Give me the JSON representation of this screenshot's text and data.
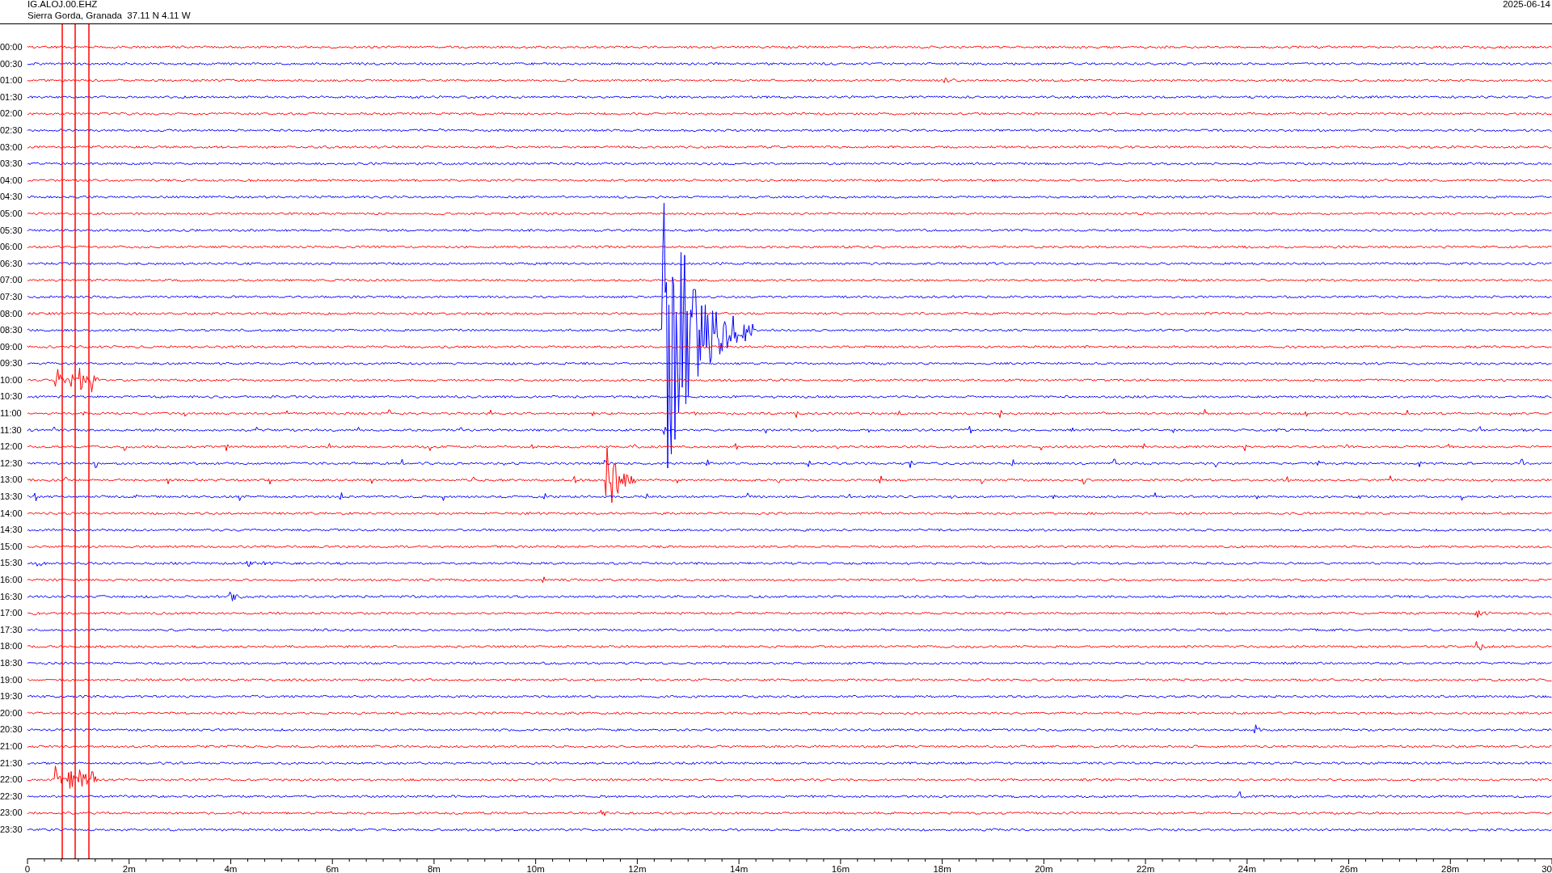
{
  "header": {
    "station": "IG.ALOJ.00.EHZ",
    "location": "Sierra Gorda, Granada  37.11 N 4.11 W",
    "date": "2025-06-14"
  },
  "rows": [
    {
      "label": "00:00",
      "color": "#ff0000"
    },
    {
      "label": "00:30",
      "color": "#0000ff"
    },
    {
      "label": "01:00",
      "color": "#ff0000"
    },
    {
      "label": "01:30",
      "color": "#0000ff"
    },
    {
      "label": "02:00",
      "color": "#ff0000"
    },
    {
      "label": "02:30",
      "color": "#0000ff"
    },
    {
      "label": "03:00",
      "color": "#ff0000"
    },
    {
      "label": "03:30",
      "color": "#0000ff"
    },
    {
      "label": "04:00",
      "color": "#ff0000"
    },
    {
      "label": "04:30",
      "color": "#0000ff"
    },
    {
      "label": "05:00",
      "color": "#ff0000"
    },
    {
      "label": "05:30",
      "color": "#0000ff"
    },
    {
      "label": "06:00",
      "color": "#ff0000"
    },
    {
      "label": "06:30",
      "color": "#0000ff"
    },
    {
      "label": "07:00",
      "color": "#ff0000"
    },
    {
      "label": "07:30",
      "color": "#0000ff"
    },
    {
      "label": "08:00",
      "color": "#ff0000"
    },
    {
      "label": "08:30",
      "color": "#0000ff"
    },
    {
      "label": "09:00",
      "color": "#ff0000"
    },
    {
      "label": "09:30",
      "color": "#0000ff"
    },
    {
      "label": "10:00",
      "color": "#ff0000"
    },
    {
      "label": "10:30",
      "color": "#0000ff"
    },
    {
      "label": "11:00",
      "color": "#ff0000"
    },
    {
      "label": "11:30",
      "color": "#0000ff"
    },
    {
      "label": "12:00",
      "color": "#ff0000"
    },
    {
      "label": "12:30",
      "color": "#0000ff"
    },
    {
      "label": "13:00",
      "color": "#ff0000"
    },
    {
      "label": "13:30",
      "color": "#0000ff"
    },
    {
      "label": "14:00",
      "color": "#ff0000"
    },
    {
      "label": "14:30",
      "color": "#0000ff"
    },
    {
      "label": "15:00",
      "color": "#ff0000"
    },
    {
      "label": "15:30",
      "color": "#0000ff"
    },
    {
      "label": "16:00",
      "color": "#ff0000"
    },
    {
      "label": "16:30",
      "color": "#0000ff"
    },
    {
      "label": "17:00",
      "color": "#ff0000"
    },
    {
      "label": "17:30",
      "color": "#0000ff"
    },
    {
      "label": "18:00",
      "color": "#ff0000"
    },
    {
      "label": "18:30",
      "color": "#0000ff"
    },
    {
      "label": "19:00",
      "color": "#ff0000"
    },
    {
      "label": "19:30",
      "color": "#0000ff"
    },
    {
      "label": "20:00",
      "color": "#ff0000"
    },
    {
      "label": "20:30",
      "color": "#0000ff"
    },
    {
      "label": "21:00",
      "color": "#ff0000"
    },
    {
      "label": "21:30",
      "color": "#0000ff"
    },
    {
      "label": "22:00",
      "color": "#ff0000"
    },
    {
      "label": "22:30",
      "color": "#0000ff"
    },
    {
      "label": "23:00",
      "color": "#ff0000"
    },
    {
      "label": "23:30",
      "color": "#0000ff"
    }
  ],
  "x_axis": {
    "ticks": [
      "0",
      "2m",
      "4m",
      "6m",
      "8m",
      "10m",
      "12m",
      "14m",
      "16m",
      "18m",
      "20m",
      "22m",
      "24m",
      "26m",
      "28m",
      "30"
    ]
  }
}
